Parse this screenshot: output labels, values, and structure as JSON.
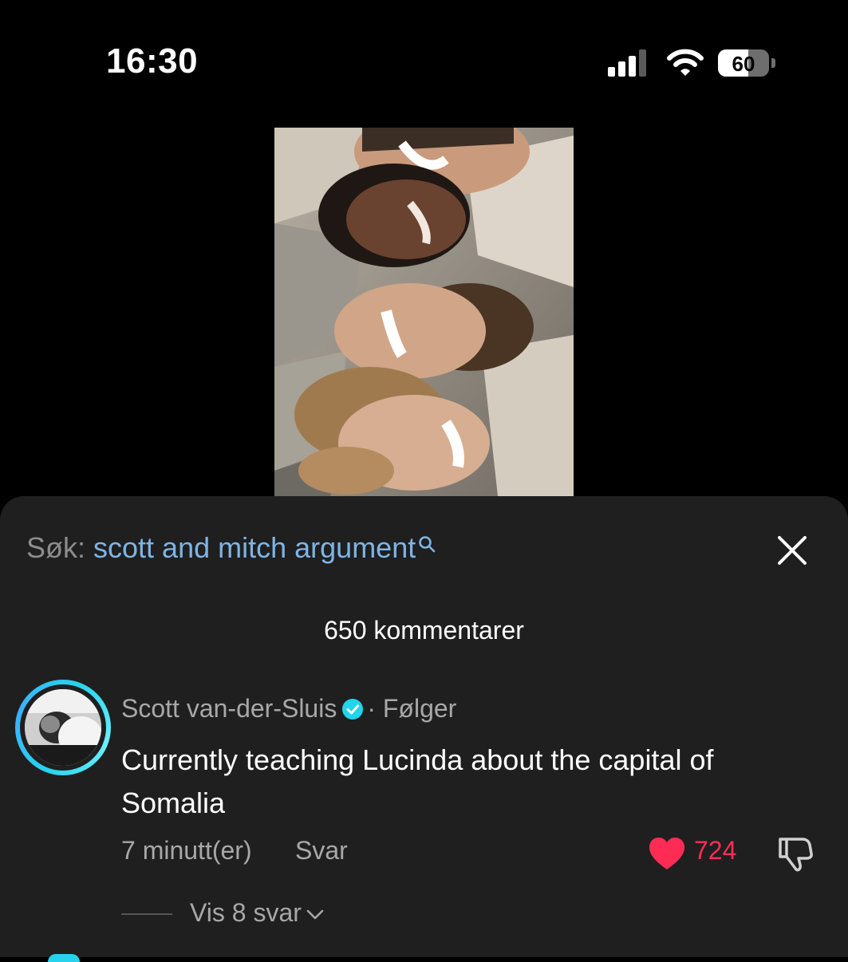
{
  "status_bar": {
    "time": "16:30",
    "battery": "60",
    "battery_level": 0.6
  },
  "video": {
    "icon": "photo-thumbnail"
  },
  "comments_sheet": {
    "search_prefix": "Søk:",
    "search_query": "scott and mitch argument",
    "count_label": "650 kommentarer",
    "comment": {
      "author": "Scott van-der-Sluis",
      "separator": "·",
      "follow_status": "Følger",
      "text": "Currently teaching Lucinda about the capital of Somalia",
      "time": "7 minutt(er)",
      "reply_label": "Svar",
      "likes": "724",
      "view_replies": "Vis 8 svar"
    }
  },
  "colors": {
    "background": "#000000",
    "sheet": "#1f1f1f",
    "link": "#7fb4e6",
    "like": "#fe2c55",
    "verified": "#20d5ec",
    "muted_text": "#a8a8a8"
  }
}
